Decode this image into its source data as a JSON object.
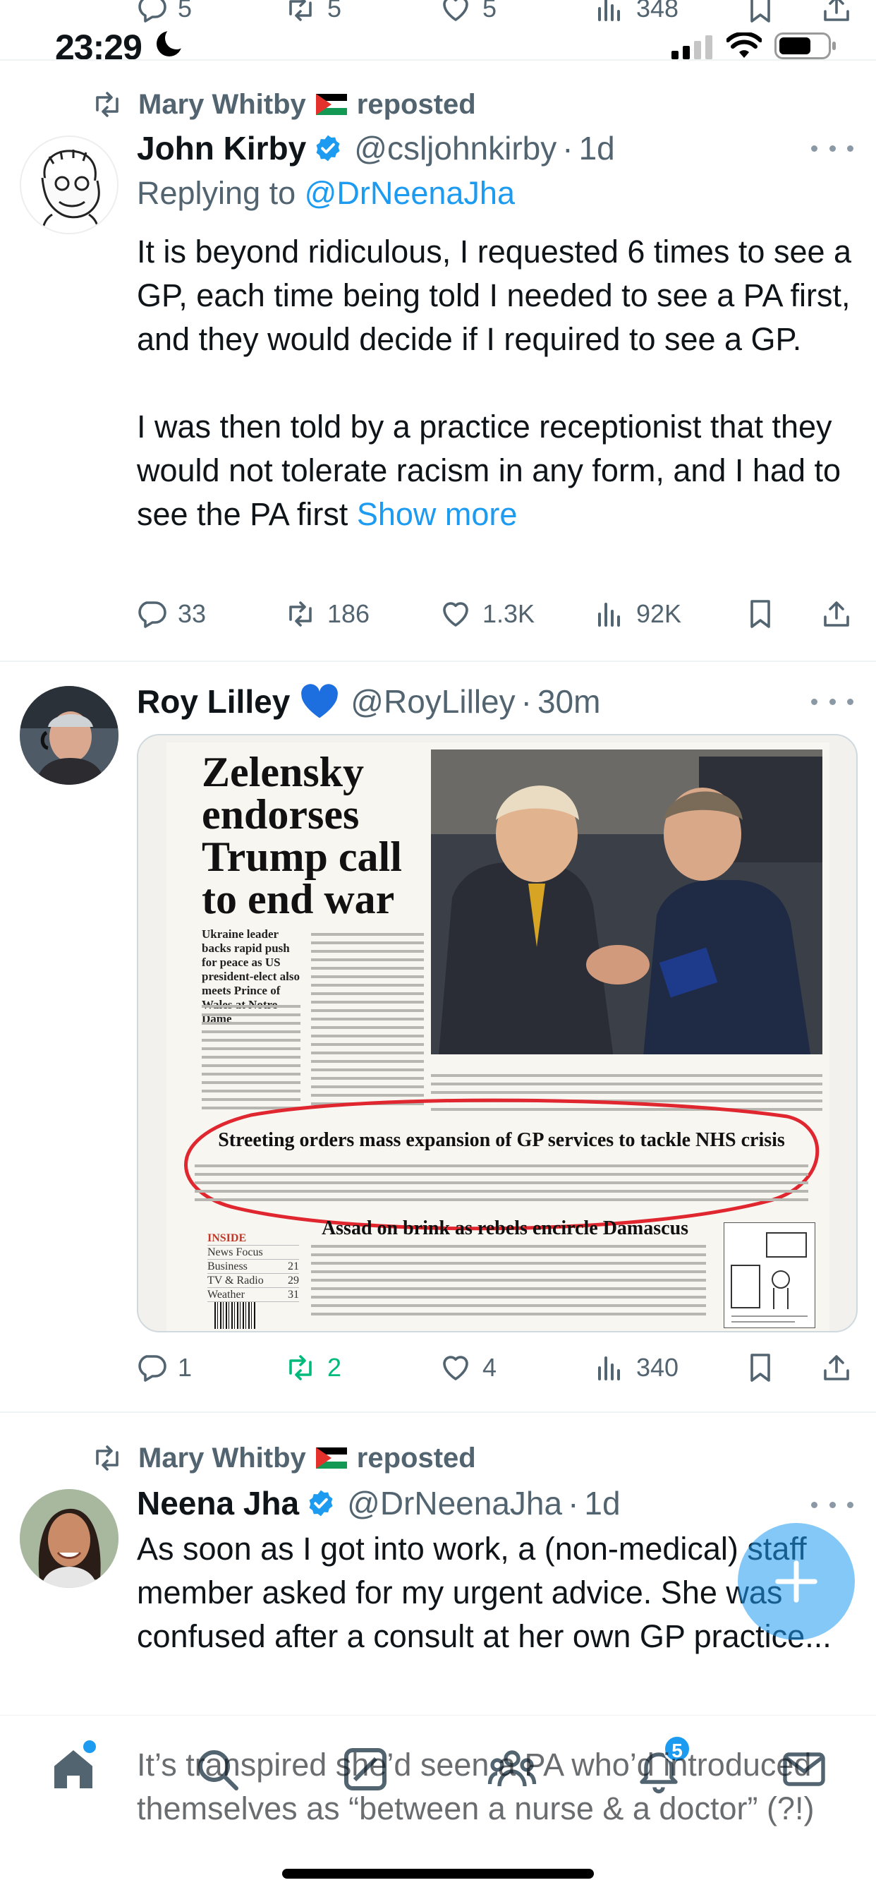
{
  "status_bar": {
    "time": "23:29"
  },
  "top_actions": {
    "replies": "5",
    "reposts": "5",
    "likes": "5",
    "views": "348"
  },
  "tweets": [
    {
      "reposted_by": "Mary Whitby",
      "reposted_label": "reposted",
      "name": "John Kirby",
      "handle": "@csljohnkirby",
      "time": "1d",
      "replying_label": "Replying to",
      "replying_handle": "@DrNeenaJha",
      "text": "It is beyond ridiculous, I requested 6 times to see a GP, each time being told I needed to see a PA first, and they would decide if I required to see a GP.\n\nI was then told by a practice receptionist that they would not tolerate racism in any form, and I had to see the PA first",
      "show_more": "Show more",
      "replies": "33",
      "reposts": "186",
      "likes": "1.3K",
      "views": "92K"
    },
    {
      "name": "Roy Lilley",
      "handle": "@RoyLilley",
      "time": "30m",
      "media": {
        "headline": "Zelensky endorses Trump call to end war",
        "deck": "Ukraine leader backs rapid push for peace as US president-elect also meets Prince of Wales at Notre-Dame",
        "banner": "Streeting orders mass expansion of GP services to tackle NHS crisis",
        "banner2": "Assad on brink as rebels encircle Damascus",
        "index": [
          {
            "label": "INSIDE",
            "page": ""
          },
          {
            "label": "News Focus",
            "page": ""
          },
          {
            "label": "Business",
            "page": "21"
          },
          {
            "label": "TV & Radio",
            "page": "29"
          },
          {
            "label": "Weather",
            "page": "31"
          }
        ]
      },
      "replies": "1",
      "reposts": "2",
      "likes": "4",
      "views": "340"
    },
    {
      "reposted_by": "Mary Whitby",
      "reposted_label": "reposted",
      "name": "Neena Jha",
      "handle": "@DrNeenaJha",
      "time": "1d",
      "text": "As soon as I got into work, a (non-medical) staff member asked for my urgent advice. She was confused after a consult at her own GP practice...",
      "overflow_text": "It’s transpired she’d seen a PA who’d introduced themselves as “between a nurse & a doctor” (?!)"
    }
  ],
  "nav": {
    "notifications_badge": "5"
  },
  "colors": {
    "accent": "#1d9bf0",
    "repost_active": "#00ba7c",
    "text": "#0f1419",
    "secondary": "#536471"
  },
  "icons": [
    "reply-icon",
    "repost-icon",
    "like-icon",
    "views-icon",
    "bookmark-icon",
    "share-icon",
    "verified-icon",
    "home-icon",
    "search-icon",
    "grok-icon",
    "communities-icon",
    "notifications-icon",
    "messages-icon",
    "compose-icon"
  ]
}
